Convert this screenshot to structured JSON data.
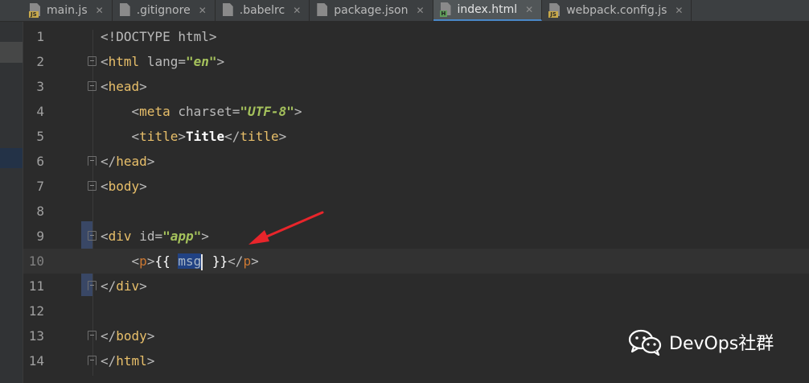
{
  "tabs": [
    {
      "label": "main.js",
      "icon": "js-file-icon",
      "badge": "JS",
      "active": false
    },
    {
      "label": ".gitignore",
      "icon": "text-file-icon",
      "badge": "",
      "active": false
    },
    {
      "label": ".babelrc",
      "icon": "config-file-icon",
      "badge": "",
      "active": false
    },
    {
      "label": "package.json",
      "icon": "json-file-icon",
      "badge": "",
      "active": false
    },
    {
      "label": "index.html",
      "icon": "html-file-icon",
      "badge": "H",
      "active": true
    },
    {
      "label": "webpack.config.js",
      "icon": "js-file-icon",
      "badge": "JS",
      "active": false
    }
  ],
  "editor": {
    "current_line": 10,
    "lines": [
      {
        "n": "1",
        "doctype": "<!DOCTYPE html>"
      },
      {
        "n": "2",
        "open": "<",
        "tag": "html",
        "attr": "lang",
        "eq": "=",
        "val": "\"en\"",
        "close": ">"
      },
      {
        "n": "3",
        "open": "<",
        "tag": "head",
        "close": ">"
      },
      {
        "n": "4",
        "open": "<",
        "tag": "meta",
        "attr": "charset",
        "eq": "=",
        "val": "\"UTF-8\"",
        "close": ">"
      },
      {
        "n": "5",
        "open": "<",
        "tag": "title",
        "close": ">",
        "text": "Title",
        "open2": "</",
        "tag2": "title",
        "close2": ">"
      },
      {
        "n": "6",
        "open": "</",
        "tag": "head",
        "close": ">"
      },
      {
        "n": "7",
        "open": "<",
        "tag": "body",
        "close": ">"
      },
      {
        "n": "8"
      },
      {
        "n": "9",
        "open": "<",
        "tag": "div",
        "attr": "id",
        "eq": "=",
        "val": "\"app\"",
        "close": ">"
      },
      {
        "n": "10",
        "open": "<",
        "tag": "p",
        "close": ">",
        "pre": "{{ ",
        "sel": "msg",
        "post": " }}",
        "open2": "</",
        "tag2": "p",
        "close2": ">"
      },
      {
        "n": "11",
        "open": "</",
        "tag": "div",
        "close": ">"
      },
      {
        "n": "12"
      },
      {
        "n": "13",
        "open": "</",
        "tag": "body",
        "close": ">"
      },
      {
        "n": "14",
        "open": "</",
        "tag": "html",
        "close": ">"
      }
    ]
  },
  "watermark": {
    "label": "DevOps社群",
    "icon": "wechat-icon"
  },
  "colors": {
    "tag": "#e8bf6a",
    "value": "#a5c25c",
    "arrow": "#e8252b",
    "selection": "#214283"
  }
}
